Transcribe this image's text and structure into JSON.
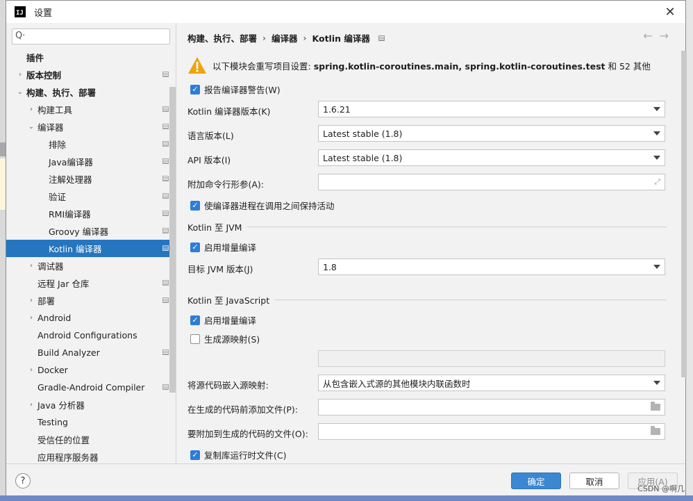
{
  "window": {
    "title": "设置",
    "logo": "IJ"
  },
  "search": {
    "placeholder": "Q·"
  },
  "tree": [
    {
      "label": "插件",
      "level": 0,
      "arrow": "",
      "bold": true,
      "cfg": false
    },
    {
      "label": "版本控制",
      "level": 0,
      "arrow": "›",
      "bold": true,
      "cfg": true
    },
    {
      "label": "构建、执行、部署",
      "level": 0,
      "arrow": "⌄",
      "bold": true,
      "cfg": false
    },
    {
      "label": "构建工具",
      "level": 1,
      "arrow": "›",
      "bold": false,
      "cfg": true
    },
    {
      "label": "编译器",
      "level": 1,
      "arrow": "⌄",
      "bold": false,
      "cfg": true
    },
    {
      "label": "排除",
      "level": 2,
      "arrow": "",
      "bold": false,
      "cfg": true
    },
    {
      "label": "Java编译器",
      "level": 2,
      "arrow": "",
      "bold": false,
      "cfg": true
    },
    {
      "label": "注解处理器",
      "level": 2,
      "arrow": "",
      "bold": false,
      "cfg": true
    },
    {
      "label": "验证",
      "level": 2,
      "arrow": "",
      "bold": false,
      "cfg": true
    },
    {
      "label": "RMI编译器",
      "level": 2,
      "arrow": "",
      "bold": false,
      "cfg": true
    },
    {
      "label": "Groovy 编译器",
      "level": 2,
      "arrow": "",
      "bold": false,
      "cfg": true
    },
    {
      "label": "Kotlin 编译器",
      "level": 2,
      "arrow": "",
      "bold": false,
      "cfg": true,
      "selected": true
    },
    {
      "label": "调试器",
      "level": 1,
      "arrow": "›",
      "bold": false,
      "cfg": false
    },
    {
      "label": "远程 Jar 仓库",
      "level": 1,
      "arrow": "",
      "bold": false,
      "cfg": true
    },
    {
      "label": "部署",
      "level": 1,
      "arrow": "›",
      "bold": false,
      "cfg": true
    },
    {
      "label": "Android",
      "level": 1,
      "arrow": "›",
      "bold": false,
      "cfg": false
    },
    {
      "label": "Android Configurations",
      "level": 1,
      "arrow": "",
      "bold": false,
      "cfg": false
    },
    {
      "label": "Build Analyzer",
      "level": 1,
      "arrow": "",
      "bold": false,
      "cfg": true
    },
    {
      "label": "Docker",
      "level": 1,
      "arrow": "›",
      "bold": false,
      "cfg": false
    },
    {
      "label": "Gradle-Android Compiler",
      "level": 1,
      "arrow": "",
      "bold": false,
      "cfg": true
    },
    {
      "label": "Java 分析器",
      "level": 1,
      "arrow": "›",
      "bold": false,
      "cfg": false
    },
    {
      "label": "Testing",
      "level": 1,
      "arrow": "",
      "bold": false,
      "cfg": false
    },
    {
      "label": "受信任的位置",
      "level": 1,
      "arrow": "",
      "bold": false,
      "cfg": false
    },
    {
      "label": "应用程序服务器",
      "level": 1,
      "arrow": "",
      "bold": false,
      "cfg": false
    }
  ],
  "breadcrumb": {
    "part1": "构建、执行、部署",
    "sep": "›",
    "part2": "编译器",
    "part3": "Kotlin 编译器",
    "back": "←",
    "forward": "→"
  },
  "warning": {
    "prefix": "以下模块会重写项目设置: ",
    "modules": "spring.kotlin-coroutines.main, spring.kotlin-coroutines.test",
    "suffix": " 和 52 其他"
  },
  "form": {
    "report_warnings": {
      "label": "报告编译器警告(W)",
      "checked": true
    },
    "compiler_version": {
      "label": "Kotlin 编译器版本(K)",
      "value": "1.6.21"
    },
    "language_version": {
      "label": "语言版本(L)",
      "value": "Latest stable (1.8)"
    },
    "api_version": {
      "label": "API 版本(I)",
      "value": "Latest stable (1.8)"
    },
    "extra_args": {
      "label": "附加命令行形参(A):",
      "value": ""
    },
    "keep_daemon": {
      "label": "使编译器进程在调用之间保持活动",
      "checked": true
    },
    "jvm_section": "Kotlin 至 JVM",
    "jvm_incremental": {
      "label": "启用增量编译",
      "checked": true
    },
    "jvm_target": {
      "label": "目标 JVM 版本(J)",
      "value": "1.8"
    },
    "js_section": "Kotlin 至 JavaScript",
    "js_incremental": {
      "label": "启用增量编译",
      "checked": true
    },
    "source_maps": {
      "label": "生成源映射(S)",
      "checked": false
    },
    "embed_sources": {
      "label": "将源代码嵌入源映射:",
      "value": "从包含嵌入式源的其他模块内联函数时"
    },
    "prefix_file": {
      "label": "在生成的代码前添加文件(P):",
      "value": ""
    },
    "postfix_file": {
      "label": "要附加到生成的代码的文件(O):",
      "value": ""
    },
    "copy_runtime": {
      "label": "复制库运行时文件(C)",
      "checked": true
    }
  },
  "footer": {
    "help": "?",
    "ok": "确定",
    "cancel": "取消",
    "apply": "应用(A)"
  },
  "watermark": "CSDN @啊几",
  "colors": {
    "accent": "#2675bf",
    "ok_button": "#3b87d2",
    "checkbox": "#2e7dd7",
    "warning": "#f0a30a"
  }
}
